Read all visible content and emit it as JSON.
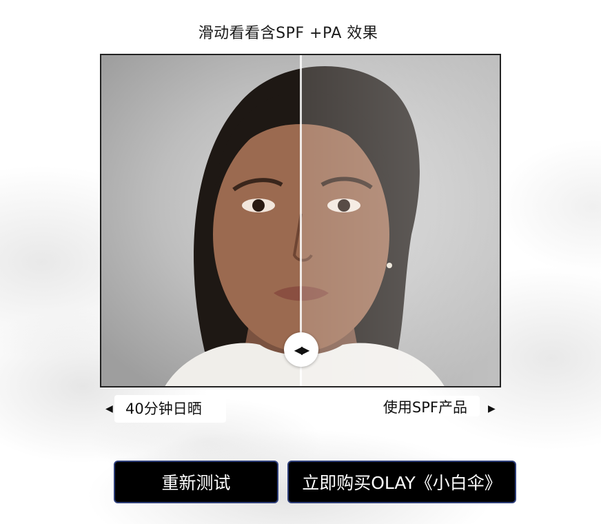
{
  "title": "滑动看看含SPF +PA 效果",
  "compare": {
    "left_label": "40分钟日晒",
    "right_label": "使用SPF产品",
    "slider_value_percent": 50
  },
  "buttons": {
    "retest_label": "重新测试",
    "buy_label": "立即购买OLAY《小白伞》"
  },
  "icons": {
    "handle": "left-right-arrows-icon",
    "left_arrow": "triangle-left-icon",
    "right_arrow": "triangle-right-icon"
  },
  "colors": {
    "button_bg": "#000000",
    "button_border": "#2e3f7a",
    "text": "#111111"
  }
}
